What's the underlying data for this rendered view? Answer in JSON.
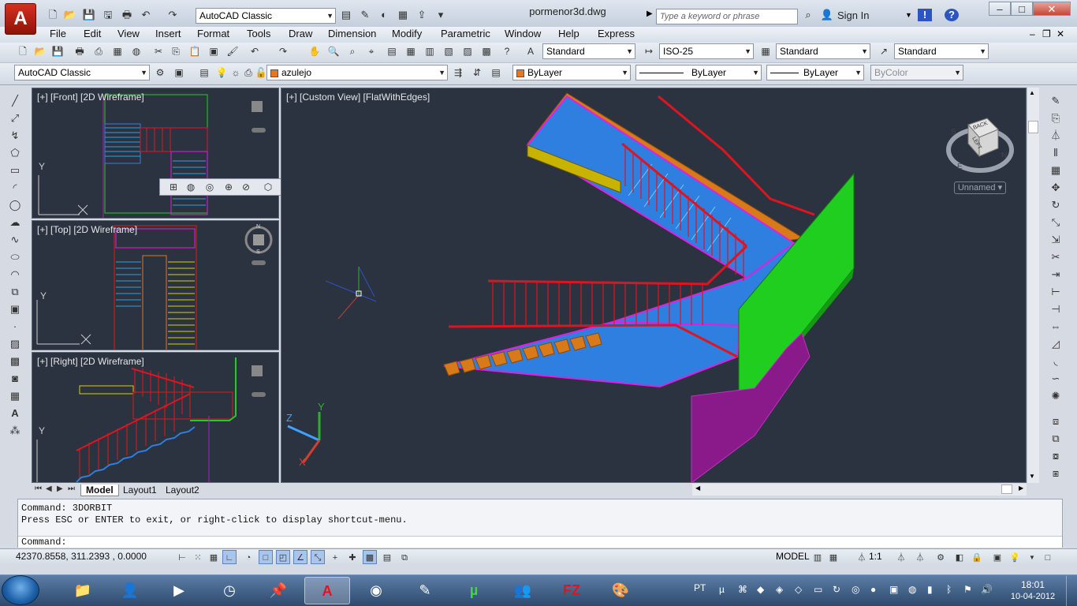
{
  "title_bar": {
    "workspace": "AutoCAD Classic",
    "document_title": "pormenor3d.dwg",
    "search_placeholder": "Type a keyword or phrase",
    "sign_in": "Sign In"
  },
  "menu": [
    "File",
    "Edit",
    "View",
    "Insert",
    "Format",
    "Tools",
    "Draw",
    "Dimension",
    "Modify",
    "Parametric",
    "Window",
    "Help",
    "Express"
  ],
  "toolbar_styles": {
    "text_style": "Standard",
    "dim_style": "ISO-25",
    "table_style": "Standard",
    "mleader_style": "Standard"
  },
  "toolbar_layers": {
    "workspace": "AutoCAD Classic",
    "layer": "azulejo",
    "layer_color": "#e8781e",
    "color": "ByLayer",
    "linetype": "ByLayer",
    "lineweight": "ByLayer",
    "plotstyle": "ByColor"
  },
  "viewports": {
    "front": "[+] [Front] [2D Wireframe]",
    "top": "[+] [Top] [2D Wireframe]",
    "right": "[+] [Right] [2D Wireframe]",
    "main": "[+] [Custom View] [FlatWithEdges]"
  },
  "view_cube": {
    "label": "Unnamed",
    "faces": [
      "BACK",
      "LEFT"
    ],
    "compass": [
      "S",
      "N",
      "E"
    ]
  },
  "axis_labels": {
    "x": "X",
    "y": "Y",
    "z": "Z",
    "ucs_y": "Y",
    "ucs_x": "X",
    "compass_n": "N",
    "compass_s": "S"
  },
  "tabs": [
    "Model",
    "Layout1",
    "Layout2"
  ],
  "command": {
    "line1": "Command: 3DORBIT",
    "line2": "Press ESC or ENTER to exit, or right-click to display shortcut-menu.",
    "prompt": "Command:"
  },
  "status": {
    "coords": "42370.8558, 311.2393 , 0.0000",
    "model": "MODEL",
    "annotation_scale": "1:1"
  },
  "taskbar": {
    "lang": "PT",
    "time": "18:01",
    "date": "10-04-2012"
  },
  "colors": {
    "viewport_bg": "#2b3341",
    "stair_blue": "#2f7fe0",
    "rail_red": "#e0141e",
    "wall_green": "#1fce1f",
    "stringer_orange": "#d87a1a",
    "edge_magenta": "#e21ee2"
  }
}
